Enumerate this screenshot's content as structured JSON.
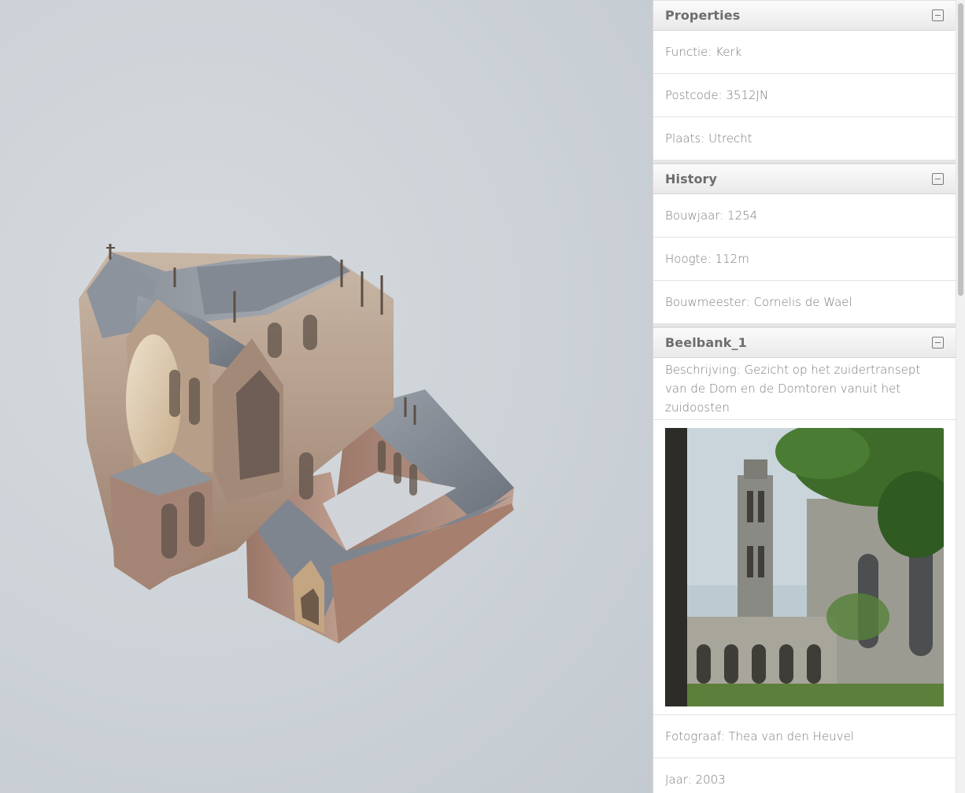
{
  "sections": [
    {
      "title": "Properties",
      "rows": [
        "Functie: Kerk",
        "Postcode: 3512JN",
        "Plaats: Utrecht"
      ]
    },
    {
      "title": "History",
      "rows": [
        "Bouwjaar: 1254",
        "Hoogte: 112m",
        "Bouwmeester: Cornelis de Wael"
      ]
    },
    {
      "title": "Beelbank_1",
      "description": "Beschrijving: Gezicht op het zuidertransept van de Dom en de Domtoren vanuit het zuidoosten",
      "photographer": "Fotograaf: Thea van den Heuvel",
      "year": "Jaar: 2003"
    }
  ],
  "icons": {
    "collapse": "minus-square-icon"
  },
  "colors": {
    "viewport_bg": "#ccd2d7",
    "roof": "#7d838c",
    "wall": "#b39a87"
  }
}
